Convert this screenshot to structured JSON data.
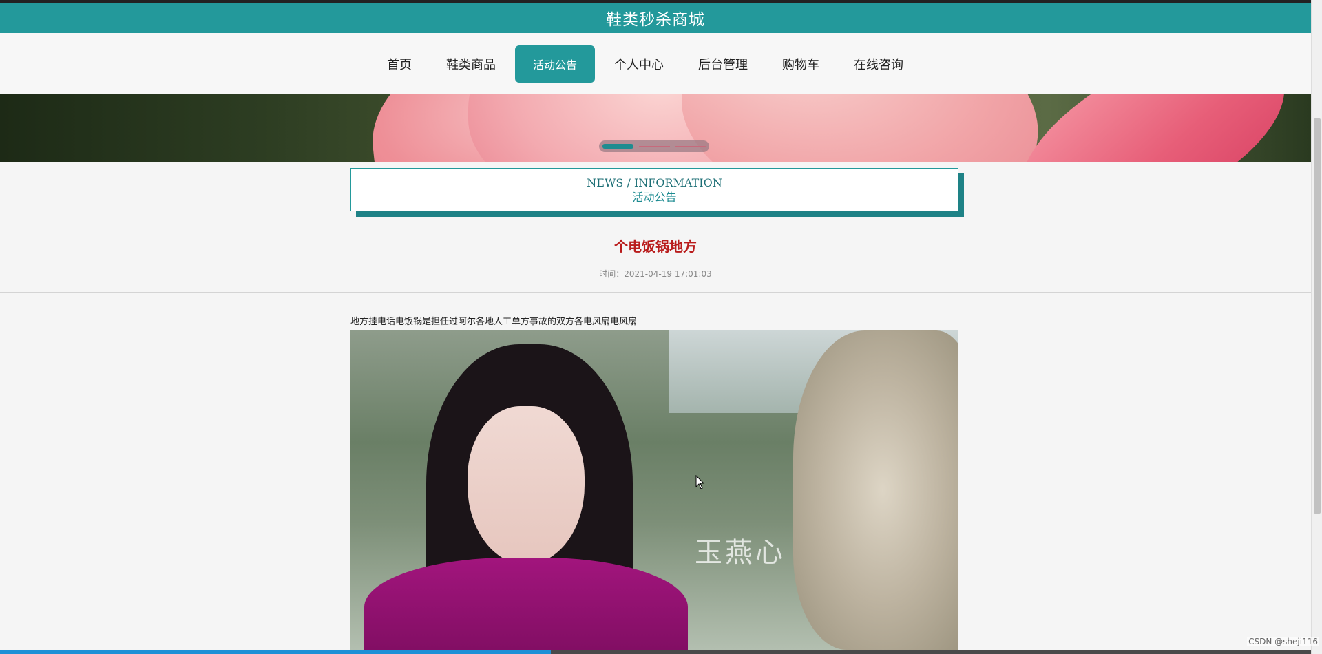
{
  "header": {
    "site_title": "鞋类秒杀商城"
  },
  "nav": {
    "items": [
      {
        "label": "首页"
      },
      {
        "label": "鞋类商品"
      },
      {
        "label": "活动公告"
      },
      {
        "label": "个人中心"
      },
      {
        "label": "后台管理"
      },
      {
        "label": "购物车"
      },
      {
        "label": "在线咨询"
      }
    ],
    "active": "活动公告"
  },
  "carousel": {
    "slide_count": 3,
    "active_index": 0
  },
  "section": {
    "title_en": "NEWS / INFORMATION",
    "title_cn": "活动公告"
  },
  "article": {
    "title": "个电饭锅地方",
    "time": "时间：2021-04-19 17:01:03",
    "body": "地方挂电话电饭锅是担任过阿尔各地人工单方事故的双方各电风扇电风扇",
    "image_watermark": "玉燕心"
  },
  "page_load_progress": 0.42,
  "watermark": "CSDN @sheji116",
  "colors": {
    "accent": "#23999b",
    "title_red": "#b91c1c",
    "page_bg": "#f5f5f5"
  }
}
